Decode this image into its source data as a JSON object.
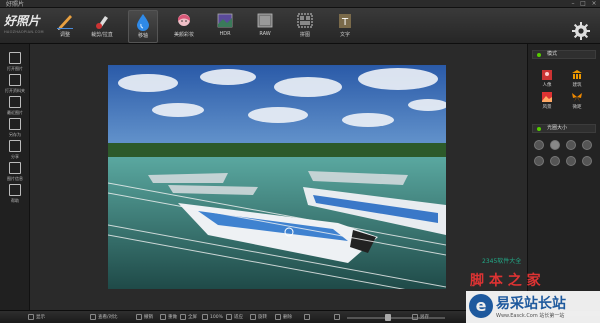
{
  "titlebar": {
    "title": "好照片"
  },
  "app": {
    "logo": "好照片",
    "logo_sub": "HAOZHAOPIAN.COM"
  },
  "toolbar": {
    "items": [
      {
        "label": "调整",
        "icon": "pencil-icon"
      },
      {
        "label": "裁剪/拉直",
        "icon": "crop-brush-icon"
      },
      {
        "label": "移轴",
        "icon": "water-drop-icon"
      },
      {
        "label": "美颜彩妆",
        "icon": "face-icon"
      },
      {
        "label": "HDR",
        "icon": "hdr-icon"
      },
      {
        "label": "RAW",
        "icon": "raw-icon"
      },
      {
        "label": "拼图",
        "icon": "collage-icon"
      },
      {
        "label": "文字",
        "icon": "text-icon"
      }
    ],
    "active_index": 2
  },
  "sidebar": {
    "items": [
      {
        "label": "打开图片"
      },
      {
        "label": "打开资料夹"
      },
      {
        "label": "最近图片"
      },
      {
        "label": "另存为"
      },
      {
        "label": "分享"
      },
      {
        "label": "图片信息"
      },
      {
        "label": "帮助"
      }
    ]
  },
  "right_panel": {
    "section1": "模式",
    "modes": [
      {
        "label": "人像",
        "color": "#d44"
      },
      {
        "label": "建筑",
        "color": "#e90"
      },
      {
        "label": "风景",
        "color": "#d33"
      },
      {
        "label": "微距",
        "color": "#e80"
      }
    ],
    "section2": "光圈大小"
  },
  "statusbar": {
    "left_label": "显示",
    "buttons": [
      "查看/对比",
      "撤销",
      "重做",
      "全屏",
      "100%",
      "适应",
      "旋转",
      "删除"
    ],
    "right_label": "另存"
  },
  "watermarks": {
    "red": "脚 本 之 家",
    "small": "2345软件大全",
    "brand": "易采站长站",
    "brand_sub": "Www.Easck.Com 站长第一站"
  },
  "colors": {
    "accent": "#3a7fd0",
    "toolbar_active": "#4a4a4a"
  }
}
